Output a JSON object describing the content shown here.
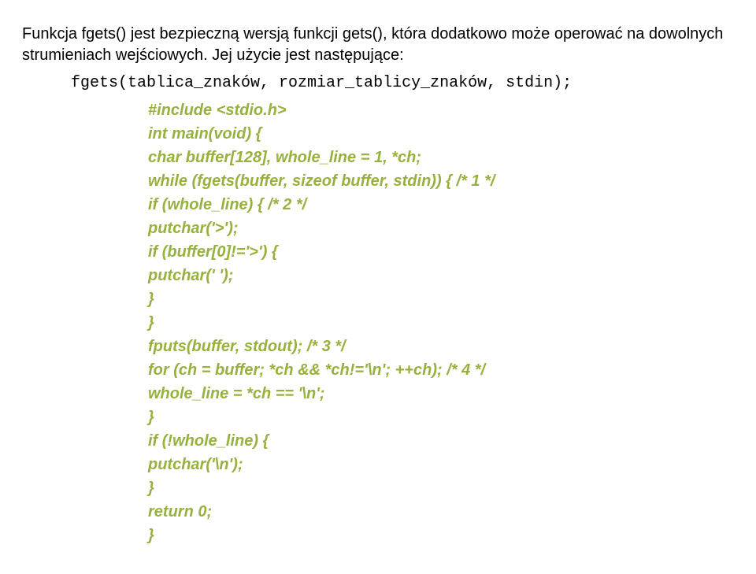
{
  "prose": "Funkcja fgets() jest bezpieczną wersją funkcji gets(), która dodatkowo może operować na dowolnych strumieniach wejściowych. Jej użycie jest następujące:",
  "usage_line": "fgets(tablica_znaków, rozmiar_tablicy_znaków, stdin);",
  "code": [
    "#include <stdio.h>",
    "int main(void) {",
    "char buffer[128], whole_line = 1, *ch;",
    "while (fgets(buffer, sizeof buffer, stdin)) { /* 1 */",
    "if (whole_line) { /* 2 */",
    "putchar('>');",
    "if (buffer[0]!='>') {",
    "putchar(' ');",
    "}",
    "}",
    "fputs(buffer, stdout); /* 3 */",
    "for (ch = buffer; *ch && *ch!='\\n'; ++ch); /* 4 */",
    "whole_line = *ch == '\\n';",
    "}",
    "if (!whole_line) {",
    "putchar('\\n');",
    "}",
    "return 0;",
    "}"
  ]
}
